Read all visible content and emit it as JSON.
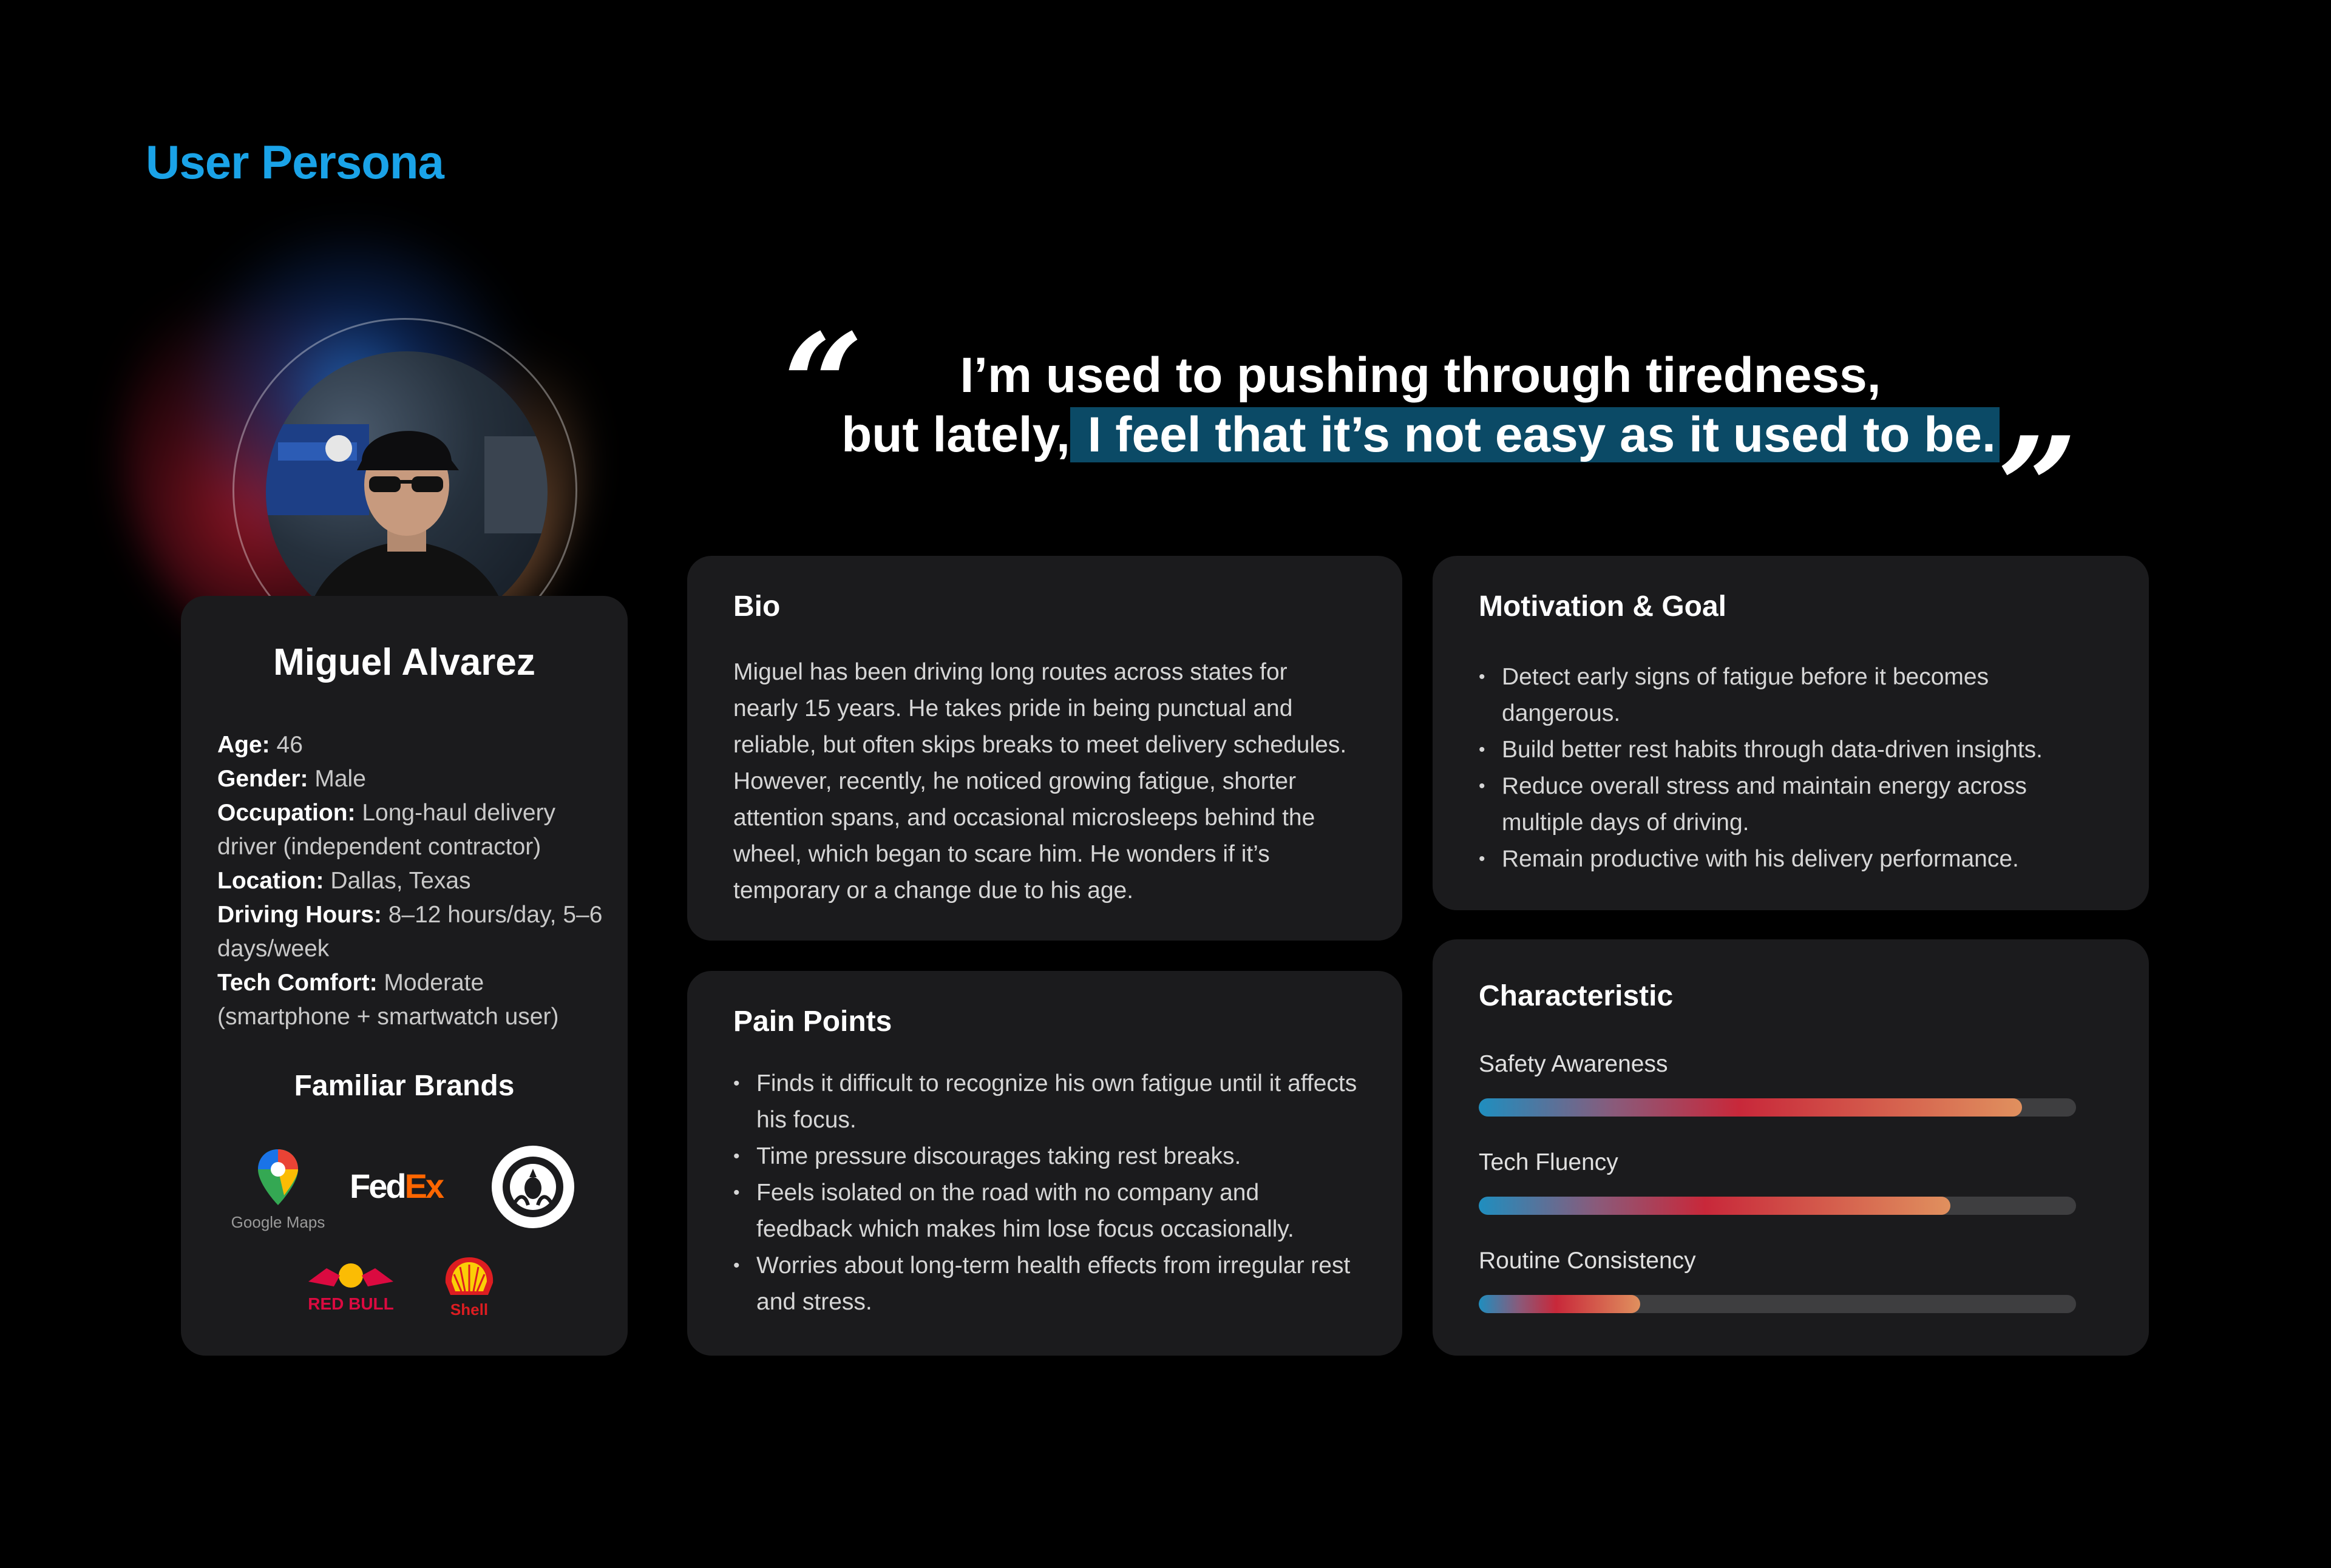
{
  "page": {
    "title": "User Persona"
  },
  "quote": {
    "open_mark": "“",
    "close_mark": "”",
    "line1": "I’m used to pushing through tiredness,",
    "line2_prefix": "but lately,",
    "line2_highlight": " I feel that it’s not easy as it used to be."
  },
  "profile": {
    "name": "Miguel Alvarez",
    "attributes": [
      {
        "key": "Age:",
        "value": " 46"
      },
      {
        "key": "Gender:",
        "value": " Male"
      },
      {
        "key": "Occupation:",
        "value": " Long-haul delivery driver (independent contractor)"
      },
      {
        "key": "Location:",
        "value": " Dallas, Texas"
      },
      {
        "key": "Driving Hours:",
        "value": " 8–12 hours/day, 5–6 days/week"
      },
      {
        "key": "Tech Comfort:",
        "value": " Moderate (smartphone + smartwatch user)"
      }
    ],
    "brands_title": "Familiar Brands",
    "brands": {
      "google_maps": "Google Maps",
      "fedex_fed": "Fed",
      "fedex_ex": "Ex",
      "red_bull": "RED BULL",
      "shell": "Shell"
    }
  },
  "bio": {
    "title": "Bio",
    "text": "Miguel has been driving long routes across states for nearly 15 years. He takes pride in being punctual and reliable, but often skips breaks to meet delivery schedules. However, recently, he noticed growing fatigue, shorter attention spans, and occasional microsleeps behind the wheel, which began to scare him. He wonders if it’s temporary or a change due to his age."
  },
  "motivation": {
    "title": "Motivation & Goal",
    "items": [
      "Detect early signs of fatigue before it becomes dangerous.",
      "Build better rest habits through data-driven insights.",
      "Reduce overall stress and maintain energy across multiple days of driving.",
      "Remain productive with his delivery performance."
    ]
  },
  "pain_points": {
    "title": "Pain Points",
    "items": [
      "Finds it difficult to recognize his own fatigue until it affects his focus.",
      "Time pressure discourages taking rest breaks.",
      "Feels isolated on the road with no company and feedback which makes him lose focus occasionally.",
      "Worries about long-term health effects from irregular rest and stress."
    ]
  },
  "characteristic": {
    "title": "Characteristic",
    "items": [
      {
        "label": "Safety Awareness",
        "level": 0.91
      },
      {
        "label": "Tech Fluency",
        "level": 0.79
      },
      {
        "label": "Routine Consistency",
        "level": 0.27
      }
    ],
    "colors": {
      "start": "#1f8ebf",
      "mid": "#c8283a",
      "end": "#e0905e",
      "track": "#3e3e40"
    }
  }
}
